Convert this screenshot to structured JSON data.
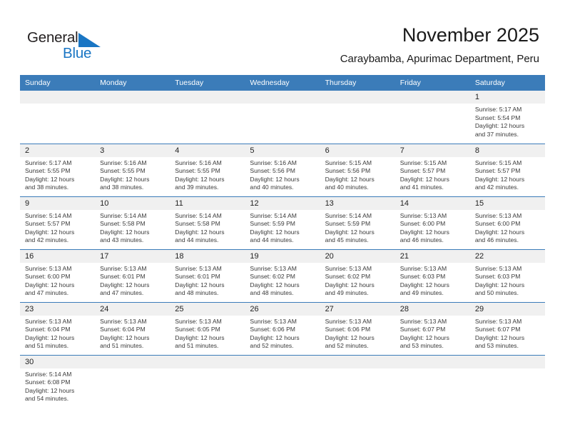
{
  "brand": {
    "name_part1": "General",
    "name_part2": "Blue",
    "flag_icon": "blue-flag-triangle",
    "color_primary": "#1a76c4",
    "color_text": "#231f20"
  },
  "header": {
    "title": "November 2025",
    "subtitle": "Caraybamba, Apurimac Department, Peru"
  },
  "theme": {
    "header_blue": "#3b7cb9",
    "daynum_band": "#f0f0f0",
    "body_text": "#3a3a3a"
  },
  "weekday_headers": [
    "Sunday",
    "Monday",
    "Tuesday",
    "Wednesday",
    "Thursday",
    "Friday",
    "Saturday"
  ],
  "weeks": [
    {
      "days": [
        {
          "num": "",
          "empty": true,
          "sunrise": "",
          "sunset": "",
          "daylight_l1": "",
          "daylight_l2": ""
        },
        {
          "num": "",
          "empty": true,
          "sunrise": "",
          "sunset": "",
          "daylight_l1": "",
          "daylight_l2": ""
        },
        {
          "num": "",
          "empty": true,
          "sunrise": "",
          "sunset": "",
          "daylight_l1": "",
          "daylight_l2": ""
        },
        {
          "num": "",
          "empty": true,
          "sunrise": "",
          "sunset": "",
          "daylight_l1": "",
          "daylight_l2": ""
        },
        {
          "num": "",
          "empty": true,
          "sunrise": "",
          "sunset": "",
          "daylight_l1": "",
          "daylight_l2": ""
        },
        {
          "num": "",
          "empty": true,
          "sunrise": "",
          "sunset": "",
          "daylight_l1": "",
          "daylight_l2": ""
        },
        {
          "num": "1",
          "empty": false,
          "sunrise": "Sunrise: 5:17 AM",
          "sunset": "Sunset: 5:54 PM",
          "daylight_l1": "Daylight: 12 hours",
          "daylight_l2": "and 37 minutes."
        }
      ]
    },
    {
      "days": [
        {
          "num": "2",
          "empty": false,
          "sunrise": "Sunrise: 5:17 AM",
          "sunset": "Sunset: 5:55 PM",
          "daylight_l1": "Daylight: 12 hours",
          "daylight_l2": "and 38 minutes."
        },
        {
          "num": "3",
          "empty": false,
          "sunrise": "Sunrise: 5:16 AM",
          "sunset": "Sunset: 5:55 PM",
          "daylight_l1": "Daylight: 12 hours",
          "daylight_l2": "and 38 minutes."
        },
        {
          "num": "4",
          "empty": false,
          "sunrise": "Sunrise: 5:16 AM",
          "sunset": "Sunset: 5:55 PM",
          "daylight_l1": "Daylight: 12 hours",
          "daylight_l2": "and 39 minutes."
        },
        {
          "num": "5",
          "empty": false,
          "sunrise": "Sunrise: 5:16 AM",
          "sunset": "Sunset: 5:56 PM",
          "daylight_l1": "Daylight: 12 hours",
          "daylight_l2": "and 40 minutes."
        },
        {
          "num": "6",
          "empty": false,
          "sunrise": "Sunrise: 5:15 AM",
          "sunset": "Sunset: 5:56 PM",
          "daylight_l1": "Daylight: 12 hours",
          "daylight_l2": "and 40 minutes."
        },
        {
          "num": "7",
          "empty": false,
          "sunrise": "Sunrise: 5:15 AM",
          "sunset": "Sunset: 5:57 PM",
          "daylight_l1": "Daylight: 12 hours",
          "daylight_l2": "and 41 minutes."
        },
        {
          "num": "8",
          "empty": false,
          "sunrise": "Sunrise: 5:15 AM",
          "sunset": "Sunset: 5:57 PM",
          "daylight_l1": "Daylight: 12 hours",
          "daylight_l2": "and 42 minutes."
        }
      ]
    },
    {
      "days": [
        {
          "num": "9",
          "empty": false,
          "sunrise": "Sunrise: 5:14 AM",
          "sunset": "Sunset: 5:57 PM",
          "daylight_l1": "Daylight: 12 hours",
          "daylight_l2": "and 42 minutes."
        },
        {
          "num": "10",
          "empty": false,
          "sunrise": "Sunrise: 5:14 AM",
          "sunset": "Sunset: 5:58 PM",
          "daylight_l1": "Daylight: 12 hours",
          "daylight_l2": "and 43 minutes."
        },
        {
          "num": "11",
          "empty": false,
          "sunrise": "Sunrise: 5:14 AM",
          "sunset": "Sunset: 5:58 PM",
          "daylight_l1": "Daylight: 12 hours",
          "daylight_l2": "and 44 minutes."
        },
        {
          "num": "12",
          "empty": false,
          "sunrise": "Sunrise: 5:14 AM",
          "sunset": "Sunset: 5:59 PM",
          "daylight_l1": "Daylight: 12 hours",
          "daylight_l2": "and 44 minutes."
        },
        {
          "num": "13",
          "empty": false,
          "sunrise": "Sunrise: 5:14 AM",
          "sunset": "Sunset: 5:59 PM",
          "daylight_l1": "Daylight: 12 hours",
          "daylight_l2": "and 45 minutes."
        },
        {
          "num": "14",
          "empty": false,
          "sunrise": "Sunrise: 5:13 AM",
          "sunset": "Sunset: 6:00 PM",
          "daylight_l1": "Daylight: 12 hours",
          "daylight_l2": "and 46 minutes."
        },
        {
          "num": "15",
          "empty": false,
          "sunrise": "Sunrise: 5:13 AM",
          "sunset": "Sunset: 6:00 PM",
          "daylight_l1": "Daylight: 12 hours",
          "daylight_l2": "and 46 minutes."
        }
      ]
    },
    {
      "days": [
        {
          "num": "16",
          "empty": false,
          "sunrise": "Sunrise: 5:13 AM",
          "sunset": "Sunset: 6:00 PM",
          "daylight_l1": "Daylight: 12 hours",
          "daylight_l2": "and 47 minutes."
        },
        {
          "num": "17",
          "empty": false,
          "sunrise": "Sunrise: 5:13 AM",
          "sunset": "Sunset: 6:01 PM",
          "daylight_l1": "Daylight: 12 hours",
          "daylight_l2": "and 47 minutes."
        },
        {
          "num": "18",
          "empty": false,
          "sunrise": "Sunrise: 5:13 AM",
          "sunset": "Sunset: 6:01 PM",
          "daylight_l1": "Daylight: 12 hours",
          "daylight_l2": "and 48 minutes."
        },
        {
          "num": "19",
          "empty": false,
          "sunrise": "Sunrise: 5:13 AM",
          "sunset": "Sunset: 6:02 PM",
          "daylight_l1": "Daylight: 12 hours",
          "daylight_l2": "and 48 minutes."
        },
        {
          "num": "20",
          "empty": false,
          "sunrise": "Sunrise: 5:13 AM",
          "sunset": "Sunset: 6:02 PM",
          "daylight_l1": "Daylight: 12 hours",
          "daylight_l2": "and 49 minutes."
        },
        {
          "num": "21",
          "empty": false,
          "sunrise": "Sunrise: 5:13 AM",
          "sunset": "Sunset: 6:03 PM",
          "daylight_l1": "Daylight: 12 hours",
          "daylight_l2": "and 49 minutes."
        },
        {
          "num": "22",
          "empty": false,
          "sunrise": "Sunrise: 5:13 AM",
          "sunset": "Sunset: 6:03 PM",
          "daylight_l1": "Daylight: 12 hours",
          "daylight_l2": "and 50 minutes."
        }
      ]
    },
    {
      "days": [
        {
          "num": "23",
          "empty": false,
          "sunrise": "Sunrise: 5:13 AM",
          "sunset": "Sunset: 6:04 PM",
          "daylight_l1": "Daylight: 12 hours",
          "daylight_l2": "and 51 minutes."
        },
        {
          "num": "24",
          "empty": false,
          "sunrise": "Sunrise: 5:13 AM",
          "sunset": "Sunset: 6:04 PM",
          "daylight_l1": "Daylight: 12 hours",
          "daylight_l2": "and 51 minutes."
        },
        {
          "num": "25",
          "empty": false,
          "sunrise": "Sunrise: 5:13 AM",
          "sunset": "Sunset: 6:05 PM",
          "daylight_l1": "Daylight: 12 hours",
          "daylight_l2": "and 51 minutes."
        },
        {
          "num": "26",
          "empty": false,
          "sunrise": "Sunrise: 5:13 AM",
          "sunset": "Sunset: 6:06 PM",
          "daylight_l1": "Daylight: 12 hours",
          "daylight_l2": "and 52 minutes."
        },
        {
          "num": "27",
          "empty": false,
          "sunrise": "Sunrise: 5:13 AM",
          "sunset": "Sunset: 6:06 PM",
          "daylight_l1": "Daylight: 12 hours",
          "daylight_l2": "and 52 minutes."
        },
        {
          "num": "28",
          "empty": false,
          "sunrise": "Sunrise: 5:13 AM",
          "sunset": "Sunset: 6:07 PM",
          "daylight_l1": "Daylight: 12 hours",
          "daylight_l2": "and 53 minutes."
        },
        {
          "num": "29",
          "empty": false,
          "sunrise": "Sunrise: 5:13 AM",
          "sunset": "Sunset: 6:07 PM",
          "daylight_l1": "Daylight: 12 hours",
          "daylight_l2": "and 53 minutes."
        }
      ]
    },
    {
      "days": [
        {
          "num": "30",
          "empty": false,
          "sunrise": "Sunrise: 5:14 AM",
          "sunset": "Sunset: 6:08 PM",
          "daylight_l1": "Daylight: 12 hours",
          "daylight_l2": "and 54 minutes."
        },
        {
          "num": "",
          "empty": true,
          "sunrise": "",
          "sunset": "",
          "daylight_l1": "",
          "daylight_l2": ""
        },
        {
          "num": "",
          "empty": true,
          "sunrise": "",
          "sunset": "",
          "daylight_l1": "",
          "daylight_l2": ""
        },
        {
          "num": "",
          "empty": true,
          "sunrise": "",
          "sunset": "",
          "daylight_l1": "",
          "daylight_l2": ""
        },
        {
          "num": "",
          "empty": true,
          "sunrise": "",
          "sunset": "",
          "daylight_l1": "",
          "daylight_l2": ""
        },
        {
          "num": "",
          "empty": true,
          "sunrise": "",
          "sunset": "",
          "daylight_l1": "",
          "daylight_l2": ""
        },
        {
          "num": "",
          "empty": true,
          "sunrise": "",
          "sunset": "",
          "daylight_l1": "",
          "daylight_l2": ""
        }
      ]
    }
  ]
}
